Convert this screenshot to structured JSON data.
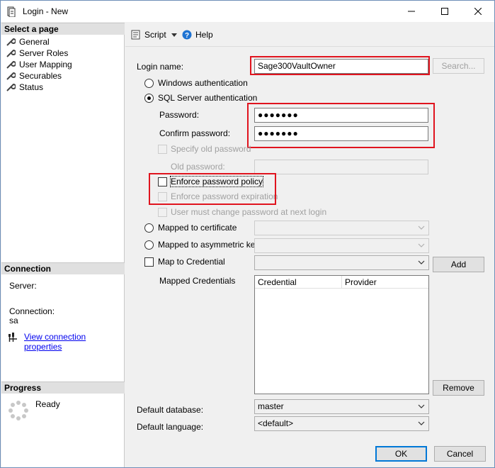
{
  "window": {
    "title": "Login - New"
  },
  "left": {
    "select_page_header": "Select a page",
    "pages": [
      {
        "label": "General",
        "icon": "wrench-icon"
      },
      {
        "label": "Server Roles",
        "icon": "wrench-icon"
      },
      {
        "label": "User Mapping",
        "icon": "wrench-icon"
      },
      {
        "label": "Securables",
        "icon": "wrench-icon"
      },
      {
        "label": "Status",
        "icon": "wrench-icon"
      }
    ],
    "connection_header": "Connection",
    "server_label": "Server:",
    "connection_label": "Connection:",
    "connection_value": "sa",
    "view_connection_link": "View connection properties",
    "progress_header": "Progress",
    "progress_status": "Ready"
  },
  "toolbar": {
    "script_label": "Script",
    "help_label": "Help"
  },
  "form": {
    "login_name_label": "Login name:",
    "login_name_value": "Sage300VaultOwner",
    "search_label": "Search...",
    "windows_auth_label": "Windows authentication",
    "sql_auth_label": "SQL Server authentication",
    "password_label": "Password:",
    "password_value": "●●●●●●●",
    "confirm_password_label": "Confirm password:",
    "confirm_password_value": "●●●●●●●",
    "specify_old_password_label": "Specify old password",
    "old_password_label": "Old password:",
    "enforce_policy_label": "Enforce password policy",
    "enforce_expiration_label": "Enforce password expiration",
    "must_change_label": "User must change password at next login",
    "mapped_cert_label": "Mapped to certificate",
    "mapped_asym_label": "Mapped to asymmetric key",
    "map_credential_label": "Map to Credential",
    "add_label": "Add",
    "mapped_credentials_label": "Mapped Credentials",
    "grid_columns": [
      "Credential",
      "Provider"
    ],
    "remove_label": "Remove",
    "default_database_label": "Default database:",
    "default_database_value": "master",
    "default_language_label": "Default language:",
    "default_language_value": "<default>"
  },
  "footer": {
    "ok_label": "OK",
    "cancel_label": "Cancel"
  },
  "colors": {
    "highlight_box": "#e0141e",
    "link": "#0000ee",
    "accent": "#0078d7"
  }
}
